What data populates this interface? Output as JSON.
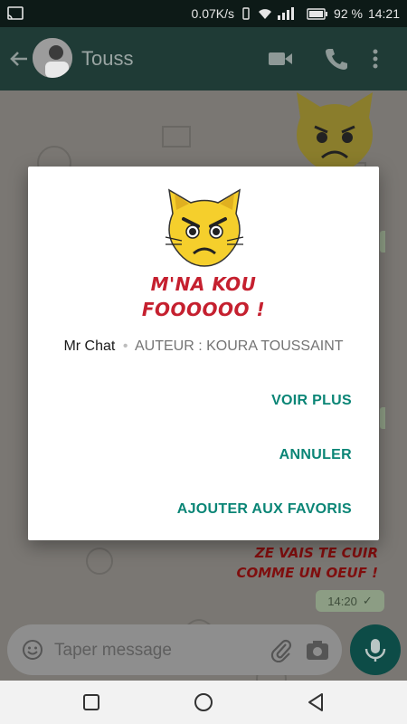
{
  "status_bar": {
    "net_speed": "0.07K/s",
    "battery": "92 %",
    "time": "14:21"
  },
  "app_bar": {
    "contact_name": "Touss"
  },
  "chat": {
    "sticker_caption_line1": "ZE VAIS TE CUIR",
    "sticker_caption_line2": "COMME UN OEUF !",
    "message_time": "14:20",
    "read_mark": "✓"
  },
  "input_bar": {
    "placeholder": "Taper message"
  },
  "dialog": {
    "sticker_text_line1": "M'NA KOU",
    "sticker_text_line2": "FOOOOOO !",
    "pack_name": "Mr Chat",
    "separator": "•",
    "author": "AUTEUR : KOURA TOUSSAINT",
    "btn_more": "VOIR PLUS",
    "btn_cancel": "ANNULER",
    "btn_favorite": "AJOUTER AUX FAVORIS"
  },
  "colors": {
    "accent": "#0a8576",
    "sticker_text": "#c5202f",
    "app_bar": "#1f3b36"
  },
  "icons": [
    "cast-icon",
    "wifi-icon",
    "signal-icon",
    "battery-icon",
    "back-arrow-icon",
    "video-call-icon",
    "phone-icon",
    "more-vert-icon",
    "emoji-icon",
    "attach-icon",
    "camera-icon",
    "mic-icon",
    "nav-recents-icon",
    "nav-home-icon",
    "nav-back-icon"
  ]
}
